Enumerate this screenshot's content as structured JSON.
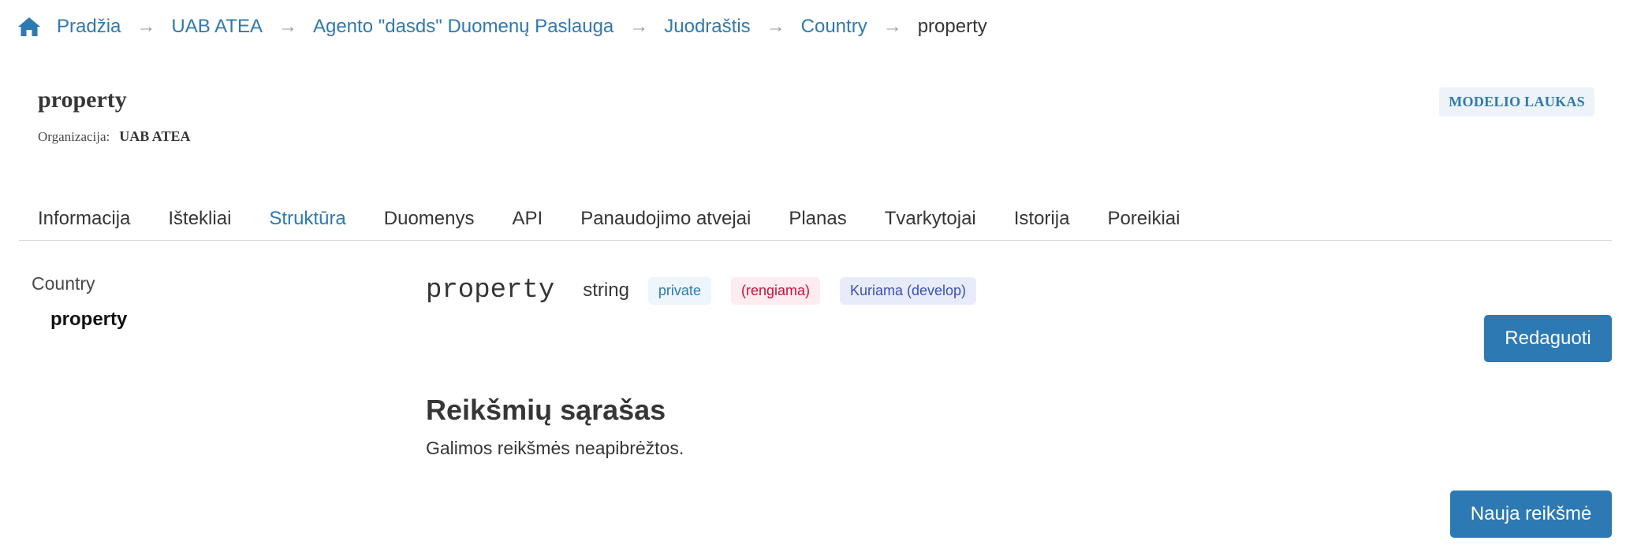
{
  "breadcrumb": {
    "items": [
      {
        "label": "Pradžia"
      },
      {
        "label": "UAB ATEA"
      },
      {
        "label": "Agento \"dasds\" Duomenų Paslauga"
      },
      {
        "label": "Juodraštis"
      },
      {
        "label": "Country"
      }
    ],
    "current": "property",
    "separator": "→"
  },
  "header": {
    "title": "property",
    "org_label": "Organizacija:",
    "org_value": "UAB ATEA",
    "type_badge": "MODELIO LAUKAS"
  },
  "tabs": [
    {
      "label": "Informacija"
    },
    {
      "label": "Ištekliai"
    },
    {
      "label": "Struktūra",
      "active": true
    },
    {
      "label": "Duomenys"
    },
    {
      "label": "API"
    },
    {
      "label": "Panaudojimo atvejai"
    },
    {
      "label": "Planas"
    },
    {
      "label": "Tvarkytojai"
    },
    {
      "label": "Istorija"
    },
    {
      "label": "Poreikiai"
    }
  ],
  "tree": {
    "root": "Country",
    "child": "property"
  },
  "field": {
    "name": "property",
    "type": "string",
    "access": "private",
    "status": "(rengiama)",
    "stage": "Kuriama (develop)"
  },
  "actions": {
    "edit_label": "Redaguoti",
    "new_value_label": "Nauja reikšmė"
  },
  "values_section": {
    "title": "Reikšmių sąrašas",
    "note": "Galimos reikšmės neapibrėžtos."
  },
  "colors": {
    "accent": "#2d79b3",
    "text": "#363636",
    "status_red": "#cc0f35",
    "stage_indigo": "#3850b7"
  },
  "icons": {
    "home": "home-icon"
  }
}
